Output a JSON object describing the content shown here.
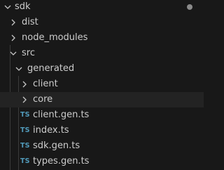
{
  "explorer": {
    "root": {
      "label": "sdk",
      "expanded": true,
      "modified_indicator": true
    },
    "items": [
      {
        "label": "dist",
        "type": "folder",
        "expanded": false,
        "level": 1
      },
      {
        "label": "node_modules",
        "type": "folder",
        "expanded": false,
        "level": 1
      },
      {
        "label": "src",
        "type": "folder",
        "expanded": true,
        "level": 1
      },
      {
        "label": "generated",
        "type": "folder",
        "expanded": true,
        "level": 2
      },
      {
        "label": "client",
        "type": "folder",
        "expanded": false,
        "level": 3
      },
      {
        "label": "core",
        "type": "folder",
        "expanded": false,
        "level": 3,
        "selected": true
      },
      {
        "label": "client.gen.ts",
        "type": "file",
        "badge": "TS",
        "level": 3
      },
      {
        "label": "index.ts",
        "type": "file",
        "badge": "TS",
        "level": 3
      },
      {
        "label": "sdk.gen.ts",
        "type": "file",
        "badge": "TS",
        "level": 3
      },
      {
        "label": "types.gen.ts",
        "type": "file",
        "badge": "TS",
        "level": 3
      }
    ]
  },
  "colors": {
    "background": "#181818",
    "text": "#cccccc",
    "chevron": "#c5c5c5",
    "selected_row": "#232323",
    "ts_badge": "#519aba",
    "modified_dot": "#8b8b8b",
    "indent_guide": "#3a3a3a"
  },
  "icons": {
    "collapsed": "chevron-right-icon",
    "expanded": "chevron-down-icon"
  }
}
